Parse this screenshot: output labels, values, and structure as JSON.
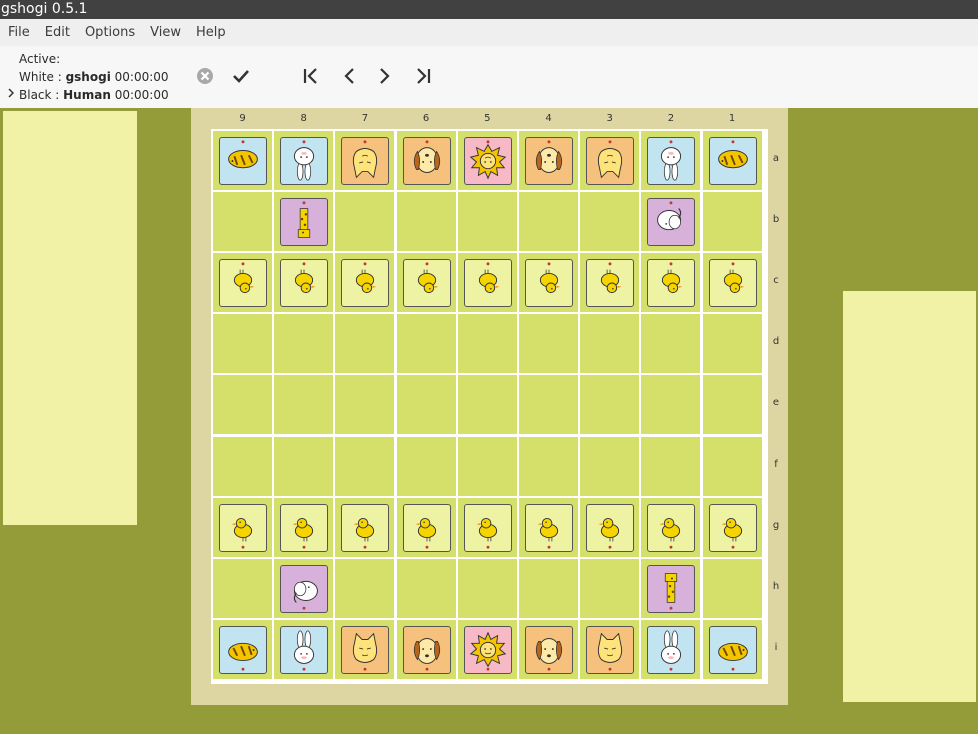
{
  "window": {
    "title": "gshogi 0.5.1"
  },
  "menu": [
    {
      "id": "file",
      "label": "File"
    },
    {
      "id": "edit",
      "label": "Edit"
    },
    {
      "id": "options",
      "label": "Options"
    },
    {
      "id": "view",
      "label": "View"
    },
    {
      "id": "help",
      "label": "Help"
    }
  ],
  "status": {
    "active_label": "Active:",
    "white_label": "White : ",
    "white_player": "gshogi",
    "white_time": "00:00:00",
    "black_label": "Black : ",
    "black_player": "Human",
    "black_time": "00:00:00",
    "expander_icon": "expander-arrow-icon"
  },
  "toolbar": {
    "buttons": [
      {
        "name": "stop",
        "icon": "cancel-icon"
      },
      {
        "name": "move-now",
        "icon": "checkmark-icon"
      },
      {
        "name": "go-first",
        "icon": "go-first-icon"
      },
      {
        "name": "go-back",
        "icon": "go-back-icon"
      },
      {
        "name": "go-forward",
        "icon": "go-forward-icon"
      },
      {
        "name": "go-last",
        "icon": "go-last-icon"
      }
    ]
  },
  "colors": {
    "background": "#939c38",
    "holding_panel": "#f2f2a6",
    "board_frame": "#ddd6a2",
    "square": "#d4e06a",
    "gold_silver_tile": "#f5c17c",
    "king_tile": "#f7b9c6",
    "lance_knight_tile": "#c2e3f0",
    "rook_bishop_tile": "#d8b1da",
    "pawn_tile": "#eef2a3"
  },
  "board": {
    "files": [
      "9",
      "8",
      "7",
      "6",
      "5",
      "4",
      "3",
      "2",
      "1"
    ],
    "ranks": [
      "a",
      "b",
      "c",
      "d",
      "e",
      "f",
      "g",
      "h",
      "i"
    ],
    "rows": [
      [
        "wL",
        "wN",
        "wS",
        "wG",
        "wK",
        "wG",
        "wS",
        "wN",
        "wL"
      ],
      [
        "",
        "wR",
        "",
        "",
        "",
        "",
        "",
        "wB",
        ""
      ],
      [
        "wP",
        "wP",
        "wP",
        "wP",
        "wP",
        "wP",
        "wP",
        "wP",
        "wP"
      ],
      [
        "",
        "",
        "",
        "",
        "",
        "",
        "",
        "",
        ""
      ],
      [
        "",
        "",
        "",
        "",
        "",
        "",
        "",
        "",
        ""
      ],
      [
        "",
        "",
        "",
        "",
        "",
        "",
        "",
        "",
        ""
      ],
      [
        "bP",
        "bP",
        "bP",
        "bP",
        "bP",
        "bP",
        "bP",
        "bP",
        "bP"
      ],
      [
        "",
        "bB",
        "",
        "",
        "",
        "",
        "",
        "bR",
        ""
      ],
      [
        "bL",
        "bN",
        "bS",
        "bG",
        "bK",
        "bG",
        "bS",
        "bN",
        "bL"
      ]
    ],
    "piece_kinds": {
      "K": "lion-piece-icon",
      "G": "dog-piece-icon",
      "S": "cat-piece-icon",
      "N": "rabbit-piece-icon",
      "L": "boar-piece-icon",
      "R": "giraffe-piece-icon",
      "B": "elephant-piece-icon",
      "P": "chick-piece-icon"
    }
  }
}
